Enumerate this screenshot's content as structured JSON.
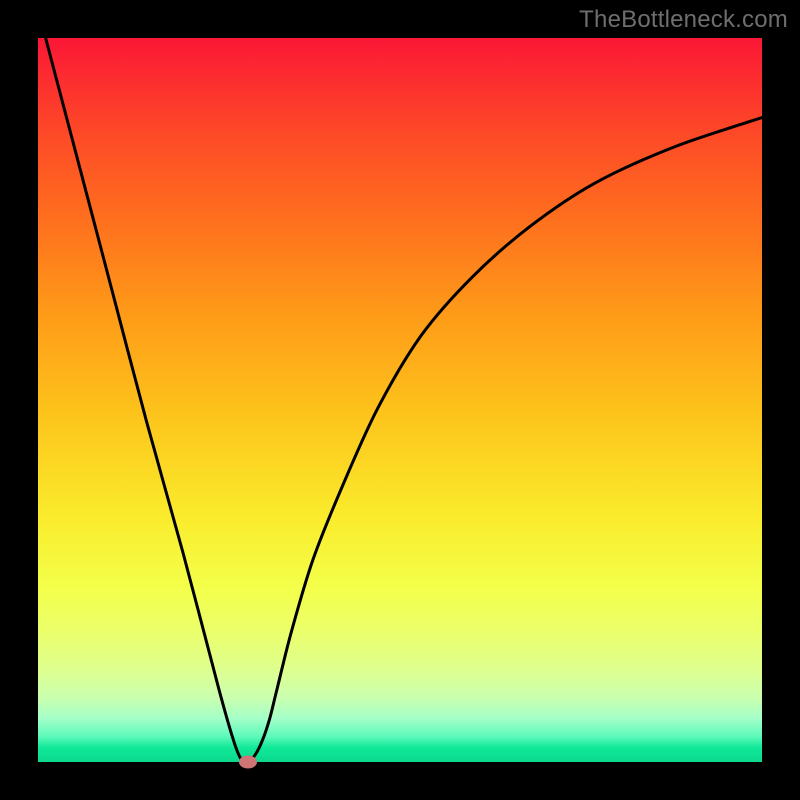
{
  "watermark": "TheBottleneck.com",
  "chart_data": {
    "type": "line",
    "title": "",
    "xlabel": "",
    "ylabel": "",
    "xlim": [
      0,
      100
    ],
    "ylim": [
      0,
      100
    ],
    "grid": false,
    "legend": false,
    "background_gradient": {
      "direction": "vertical",
      "stops": [
        {
          "pct": 0,
          "color": "#fb1736"
        },
        {
          "pct": 25,
          "color": "#fe6f1e"
        },
        {
          "pct": 52,
          "color": "#fdc41b"
        },
        {
          "pct": 76,
          "color": "#f3ff4a"
        },
        {
          "pct": 92,
          "color": "#b9ffba"
        },
        {
          "pct": 100,
          "color": "#0bd88c"
        }
      ]
    },
    "series": [
      {
        "name": "bottleneck-curve",
        "color": "#000000",
        "x": [
          0,
          5,
          10,
          15,
          20,
          25,
          27,
          28,
          29,
          30,
          31,
          32,
          33,
          35,
          38,
          42,
          47,
          53,
          60,
          68,
          77,
          88,
          100
        ],
        "y": [
          104,
          85,
          66,
          47,
          29,
          10,
          3,
          0.5,
          0,
          1,
          3,
          6,
          10,
          18,
          28,
          38,
          49,
          59,
          67,
          74,
          80,
          85,
          89
        ]
      }
    ],
    "marker": {
      "name": "optimal-point",
      "x": 29,
      "y": 0,
      "color": "#cf7576"
    }
  }
}
